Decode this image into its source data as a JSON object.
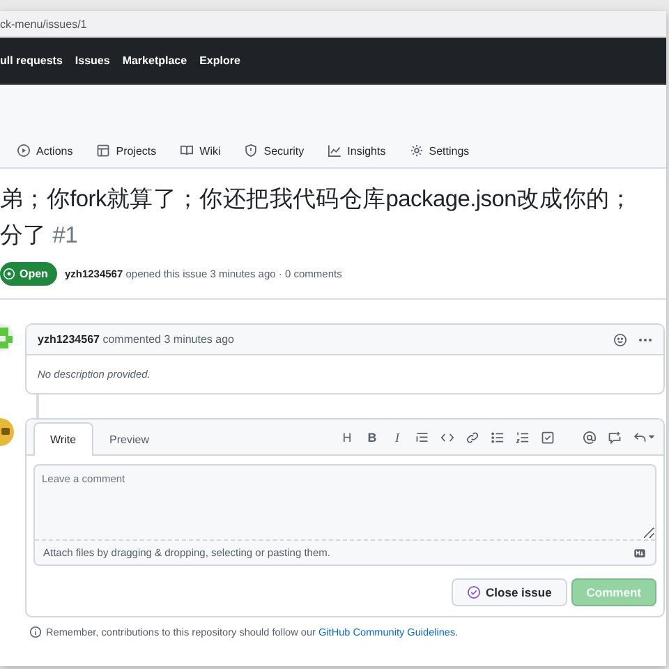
{
  "address_bar": {
    "url": "ck-menu/issues/1"
  },
  "nav": {
    "items": [
      "ull requests",
      "Issues",
      "Marketplace",
      "Explore"
    ]
  },
  "repo_tabs": [
    {
      "label": "Actions"
    },
    {
      "label": "Projects"
    },
    {
      "label": "Wiki"
    },
    {
      "label": "Security"
    },
    {
      "label": "Insights"
    },
    {
      "label": "Settings"
    }
  ],
  "issue": {
    "title_lines": [
      "弟；你fork就算了；你还把我代码仓库package.json改成你的；",
      "分了"
    ],
    "number": "#1",
    "status": "Open",
    "author": "yzh1234567",
    "meta": "opened this issue 3 minutes ago · 0 comments"
  },
  "comment": {
    "author": "yzh1234567",
    "meta": "commented 3 minutes ago",
    "body": "No description provided."
  },
  "composer": {
    "tabs": [
      {
        "label": "Write",
        "selected": true
      },
      {
        "label": "Preview",
        "selected": false
      }
    ],
    "toolbar_letters": [
      "H",
      "B",
      "I"
    ],
    "placeholder": "Leave a comment",
    "attach_hint": "Attach files by dragging & dropping, selecting or pasting them.",
    "close_button": "Close issue",
    "comment_button": {
      "label": "Comment",
      "disabled": true
    }
  },
  "footer": {
    "text": "Remember, contributions to this repository should follow our",
    "link": "GitHub Community Guidelines",
    "end": "."
  }
}
